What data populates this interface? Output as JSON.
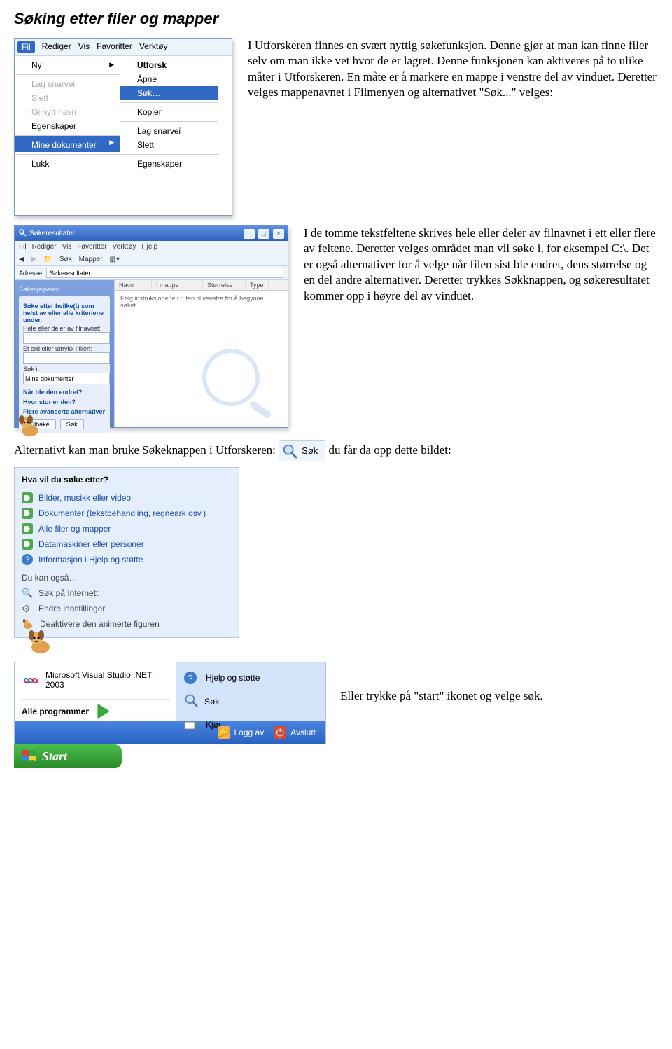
{
  "title": "Søking etter filer og mapper",
  "intro": "I Utforskeren finnes en svært nyttig søkefunksjon. Denne gjør at man kan finne filer selv om man ikke vet hvor de er lagret. Denne funksjonen kan aktiveres på to ulike måter i Utforskeren. En måte er å markere en mappe i venstre del av vinduet. Deretter velges mappenavnet i Filmenyen og alternativet \"Søk...\" velges:",
  "menubar": {
    "fil": "Fil",
    "rediger": "Rediger",
    "vis": "Vis",
    "favoritter": "Favoritter",
    "verktoy": "Verktøy"
  },
  "fileMenu": {
    "ny": "Ny",
    "lag_snarvei": "Lag snarvei",
    "slett": "Slett",
    "gi_nytt_navn": "Gi nytt navn",
    "egenskaper": "Egenskaper",
    "mine_dokumenter": "Mine dokumenter",
    "lukk": "Lukk"
  },
  "ctxMenu": {
    "utforsk": "Utforsk",
    "apne": "Åpne",
    "sok": "Søk…",
    "kopier": "Kopier",
    "lag_snarvei": "Lag snarvei",
    "slett": "Slett",
    "egenskaper": "Egenskaper"
  },
  "para2": "I de tomme tekstfeltene skrives hele eller deler av filnavnet i ett eller flere av feltene. Deretter velges området man vil søke i, for eksempel C:\\. Det er også alternativer for å velge når filen sist ble endret, dens størrelse og en del andre alternativer. Deretter trykkes Søkknappen, og søkeresultatet kommer opp i høyre del av vinduet.",
  "sr": {
    "title": "Søkeresultater",
    "menus": [
      "Fil",
      "Rediger",
      "Vis",
      "Favoritter",
      "Verktøy",
      "Hjelp"
    ],
    "toolbar": [
      "Søk",
      "Mapper"
    ],
    "addr_label": "Adresse",
    "addr_value": "Søkeresultater",
    "cols": [
      "Navn",
      "I mappe",
      "Størrelse",
      "Type"
    ],
    "hint": "Følg instruksjonene i ruten til venstre for å begynne søket.",
    "side_title": "Søkehjelperen",
    "q1": "Søke etter hvilke(t) som helst av eller alle kriteriene under.",
    "lbl1": "Hele eller deler av filnavnet:",
    "lbl2": "Et ord eller uttrykk i filen:",
    "lbl3": "Søk i:",
    "lookin": "Mine dokumenter",
    "opt1": "Når ble den endret?",
    "opt2": "Hvor stor er den?",
    "opt3": "Flere avanserte alternativer",
    "back": "Tilbake",
    "search": "Søk"
  },
  "altLinePre": "Alternativt kan man bruke Søkeknappen i Utforskeren: ",
  "altLinePost": " du får da opp dette bildet:",
  "sokBtn": "Søk",
  "panel": {
    "hd": "Hva vil du søke etter?",
    "i1": "Bilder, musikk eller video",
    "i2": "Dokumenter (tekstbehandling, regneark osv.)",
    "i3": "Alle filer og mapper",
    "i4": "Datamaskiner eller personer",
    "i5": "Informasjon i Hjelp og støtte",
    "you_can": "Du kan også…",
    "i6": "Søk på Internett",
    "i7": "Endre innstillinger",
    "i8": "Deaktivere den animerte figuren"
  },
  "lastLine": "Eller trykke på \"start\" ikonet og velge søk.",
  "start": {
    "vs": "Microsoft Visual Studio .NET 2003",
    "allp": "Alle programmer",
    "help": "Hjelp og støtte",
    "search": "Søk",
    "run": "Kjør…",
    "logoff": "Logg av",
    "shutdown": "Avslutt",
    "start": "Start"
  }
}
